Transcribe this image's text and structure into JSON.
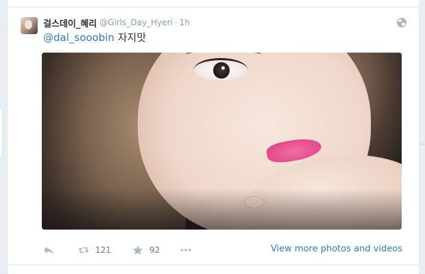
{
  "tweet": {
    "display_name": "걸스데이_혜리",
    "handle": "@Girls_Day_Hyeri",
    "separator": "·",
    "time": "1h",
    "mention": "@dal_sooobin",
    "text": "자지맛",
    "icons": {
      "avatar": "profile-photo",
      "globe": "globe-icon"
    }
  },
  "actions": {
    "retweet_count": "121",
    "favorite_count": "92",
    "view_more_label": "View more photos and videos",
    "icons": [
      "reply-icon",
      "retweet-icon",
      "star-icon",
      "more-dots-icon"
    ]
  },
  "colors": {
    "link": "#2b7bb9",
    "text": "#292f33",
    "muted": "#8899a6",
    "lip_pink": "#e54d8d"
  }
}
